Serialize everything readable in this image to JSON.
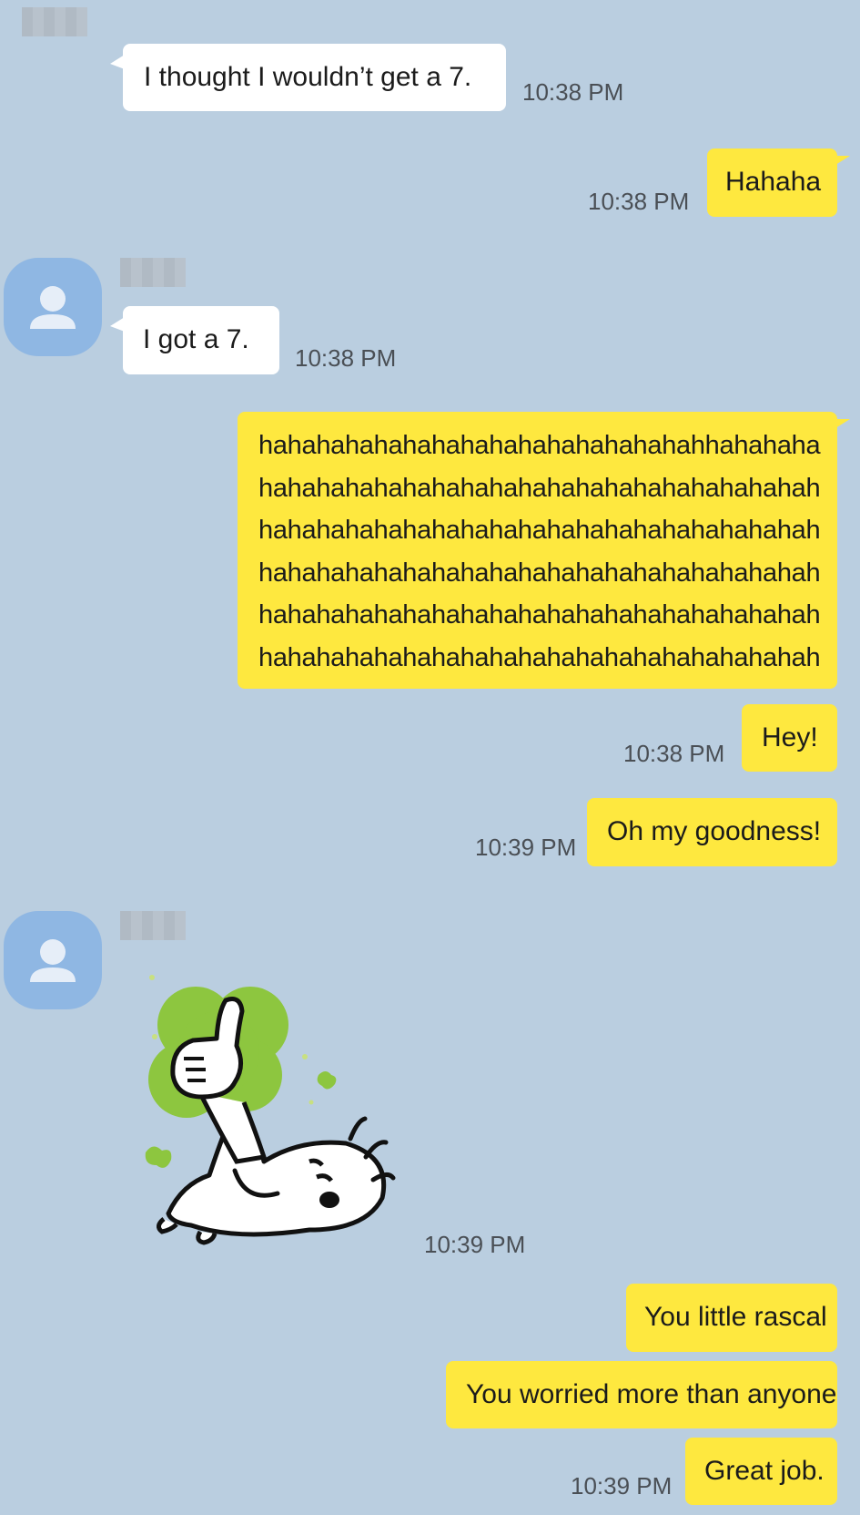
{
  "colors": {
    "background": "#bacee0",
    "incoming_bubble": "#ffffff",
    "outgoing_bubble": "#fee83f",
    "avatar": "#8fb7e3"
  },
  "messages": {
    "m1": {
      "text": "I thought I wouldn’t get a 7.",
      "time": "10:38 PM"
    },
    "m2": {
      "text": "Hahaha",
      "time": "10:38 PM"
    },
    "m3": {
      "text": "I got a 7.",
      "time": "10:38 PM"
    },
    "m4": {
      "lines": [
        "hahahahahahahahahahahahahahahahhahahaha",
        "hahahahahahahahahahahahahahahahahahahah",
        "hahahahahahahahahahahahahahahahahahahah",
        "hahahahahahahahahahahahahahahahahahahah",
        "hahahahahahahahahahahahahahahahahahahah",
        "hahahahahahahahahahahahahahahahahahahah"
      ]
    },
    "m5": {
      "text": "Hey!",
      "time": "10:38 PM"
    },
    "m6": {
      "text": "Oh my goodness!",
      "time": "10:39 PM"
    },
    "m7": {
      "sticker": "thumbs-up-bunny-sticker",
      "time": "10:39 PM"
    },
    "m8": {
      "text": "You little rascal"
    },
    "m9": {
      "text": "You worried more than anyone"
    },
    "m10": {
      "text": "Great job.",
      "time": "10:39 PM"
    }
  },
  "icons": {
    "avatar": "default-person-icon"
  }
}
